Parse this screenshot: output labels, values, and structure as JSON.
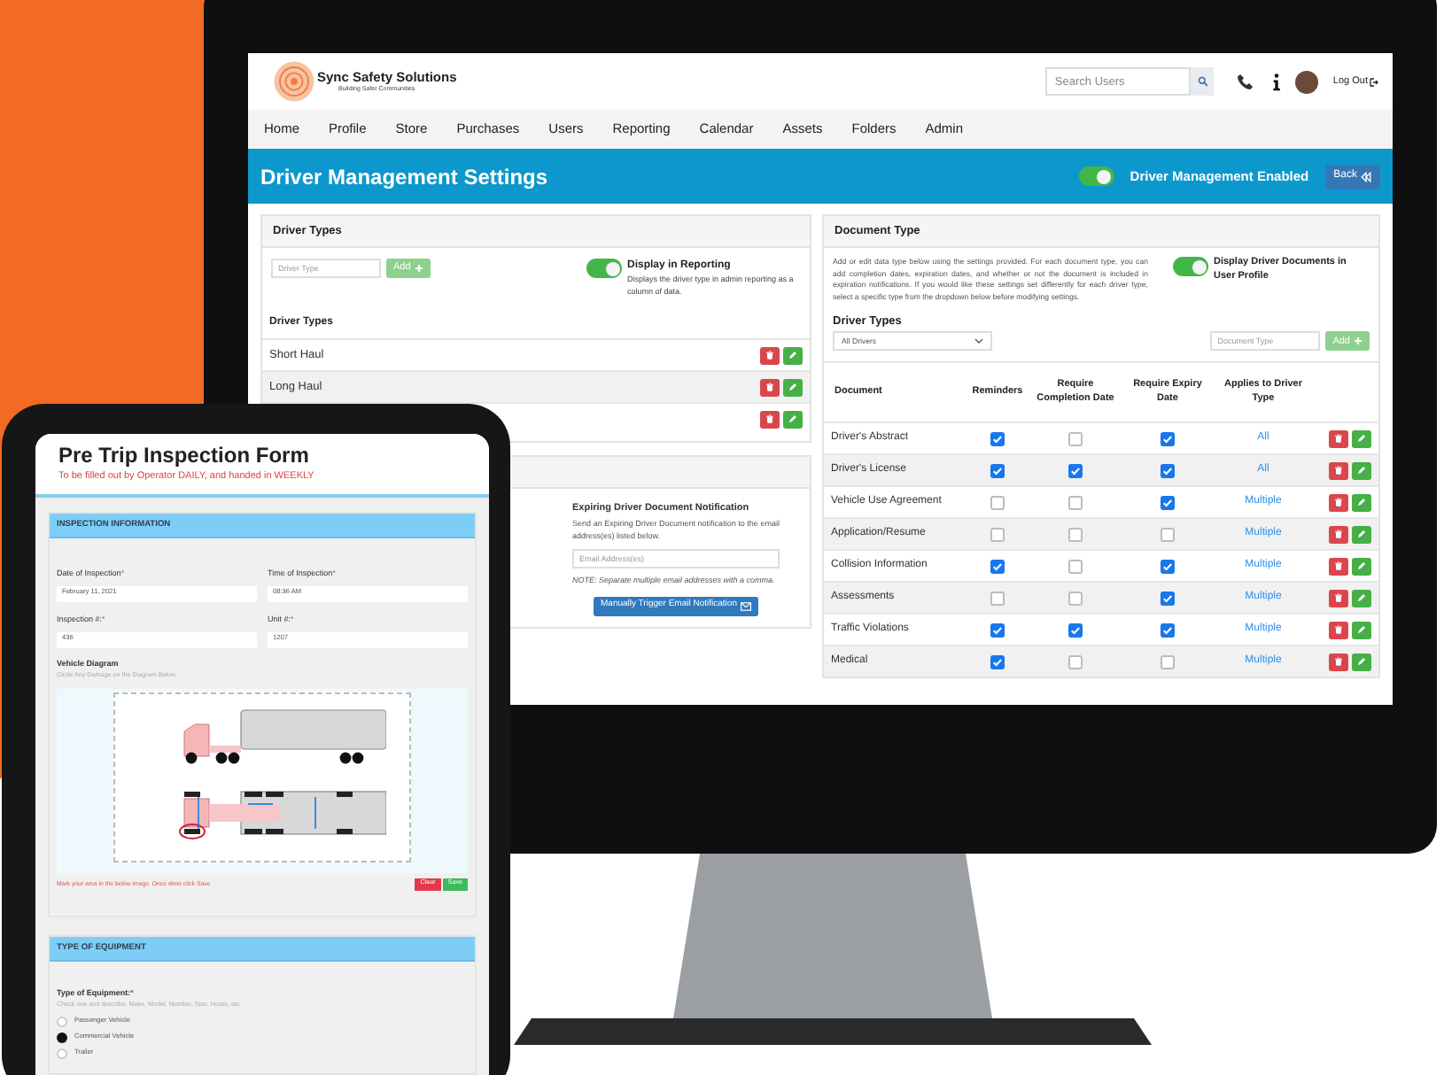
{
  "monitor": {
    "header": {
      "logo_name": "Sync Safety Solutions",
      "logo_tagline": "Building Safer Communities",
      "search_placeholder": "Search Users",
      "logout": "Log Out"
    },
    "nav": [
      "Home",
      "Profile",
      "Store",
      "Purchases",
      "Users",
      "Reporting",
      "Calendar",
      "Assets",
      "Folders",
      "Admin"
    ],
    "title_bar": {
      "title": "Driver Management Settings",
      "toggle_on": true,
      "toggle_label": "Driver Management Enabled",
      "back": "Back"
    },
    "driver_types_card": {
      "heading": "Driver Types",
      "input_placeholder": "Driver Type",
      "add": "Add",
      "reporting_toggle": {
        "on": true,
        "label": "Display in Reporting",
        "description": "Displays the driver type in admin reporting as a column of data."
      },
      "list_heading": "Driver Types",
      "rows": [
        {
          "name": "Short Haul"
        },
        {
          "name": "Long Haul"
        },
        {}
      ]
    },
    "notification_card": {
      "title": "Expiring Driver Document Notification",
      "description": "Send an Expiring Driver Document notification to the email address(es) listed below.",
      "email_placeholder": "Email Address(es)",
      "note": "NOTE: Separate multiple email addresses with a comma.",
      "button": "Manually Trigger Email Notification"
    },
    "document_card": {
      "heading": "Document Type",
      "description": "Add or edit data type below using the settings provided. For each document type, you can add completion dates, expiration dates, and whether or not the document is included in expiration notifications. If you would like these settings set differently for each driver type, select a specific type from the dropdown below before modifying settings.",
      "profile_toggle": {
        "on": true,
        "label": "Display Driver Documents in User Profile"
      },
      "driver_types_label": "Driver Types",
      "select_value": "All Drivers",
      "doc_type_placeholder": "Document Type",
      "add": "Add",
      "columns": [
        "Document",
        "Reminders",
        "Require Completion Date",
        "Require Expiry Date",
        "Applies to Driver Type"
      ],
      "rows": [
        {
          "document": "Driver's Abstract",
          "reminders": true,
          "completion": false,
          "expiry": true,
          "applies": "All"
        },
        {
          "document": "Driver's License",
          "reminders": true,
          "completion": true,
          "expiry": true,
          "applies": "All"
        },
        {
          "document": "Vehicle Use Agreement",
          "reminders": false,
          "completion": false,
          "expiry": true,
          "applies": "Multiple"
        },
        {
          "document": "Application/Resume",
          "reminders": false,
          "completion": false,
          "expiry": false,
          "applies": "Multiple"
        },
        {
          "document": "Collision Information",
          "reminders": true,
          "completion": false,
          "expiry": true,
          "applies": "Multiple"
        },
        {
          "document": "Assessments",
          "reminders": false,
          "completion": false,
          "expiry": true,
          "applies": "Multiple"
        },
        {
          "document": "Traffic Violations",
          "reminders": true,
          "completion": true,
          "expiry": true,
          "applies": "Multiple"
        },
        {
          "document": "Medical",
          "reminders": true,
          "completion": false,
          "expiry": false,
          "applies": "Multiple"
        }
      ]
    }
  },
  "tablet": {
    "title": "Pre Trip Inspection Form",
    "subtitle": "To be filled out by Operator DAILY, and handed in WEEKLY",
    "sections": [
      {
        "kind": "inspection",
        "heading": "INSPECTION INFORMATION",
        "fields": [
          {
            "label": "Date of Inspection",
            "mark": "*",
            "value": "February 11, 2021"
          },
          {
            "label": "Time of Inspection",
            "mark": "*",
            "value": "08:36 AM"
          },
          {
            "label": "Inspection #:",
            "mark": "*",
            "value": "436"
          },
          {
            "label": "Unit #:",
            "mark": "*",
            "value": "1207"
          }
        ],
        "diagram": {
          "label": "Vehicle Diagram",
          "hint": "Circle Any Damage on the Diagram Below",
          "instruction": "Mark your area in the below image. Once done click Save",
          "clear": "Clear",
          "save": "Save"
        }
      },
      {
        "kind": "equipment",
        "heading": "TYPE OF EQUIPMENT",
        "question": "Type of Equipment:",
        "mark": "*",
        "hint": "Check one and describe: Make, Model, Number, Size, Hours, etc.",
        "options": [
          {
            "label": "Passenger Vehicle",
            "selected": false
          },
          {
            "label": "Commercial Vehicle",
            "selected": true
          },
          {
            "label": "Trailer",
            "selected": false
          }
        ]
      }
    ]
  }
}
